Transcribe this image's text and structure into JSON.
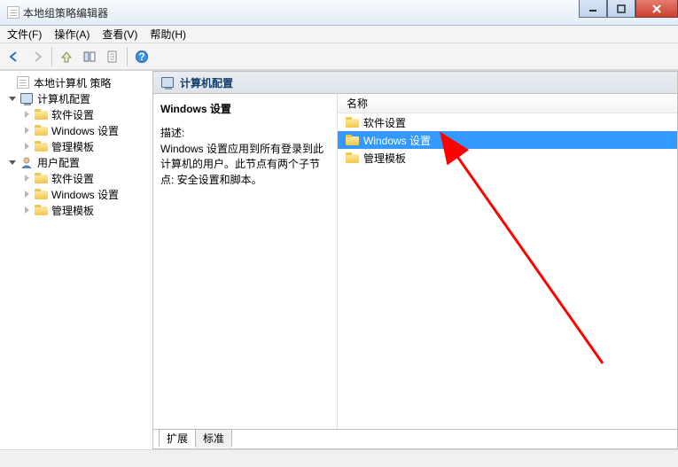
{
  "title": "本地组策略编辑器",
  "menus": {
    "file": "文件(F)",
    "action": "操作(A)",
    "view": "查看(V)",
    "help": "帮助(H)"
  },
  "tree": {
    "root": "本地计算机 策略",
    "computer_cfg": "计算机配置",
    "user_cfg": "用户配置",
    "software": "软件设置",
    "winset": "Windows 设置",
    "tmpl": "管理模板"
  },
  "header": "计算机配置",
  "desc": {
    "title": "Windows 设置",
    "label": "描述:",
    "body": "Windows 设置应用到所有登录到此计算机的用户。此节点有两个子节点: 安全设置和脚本。"
  },
  "list": {
    "col_name": "名称",
    "items": [
      "软件设置",
      "Windows 设置",
      "管理模板"
    ],
    "selected_index": 1
  },
  "tabs": {
    "extended": "扩展",
    "standard": "标准"
  }
}
